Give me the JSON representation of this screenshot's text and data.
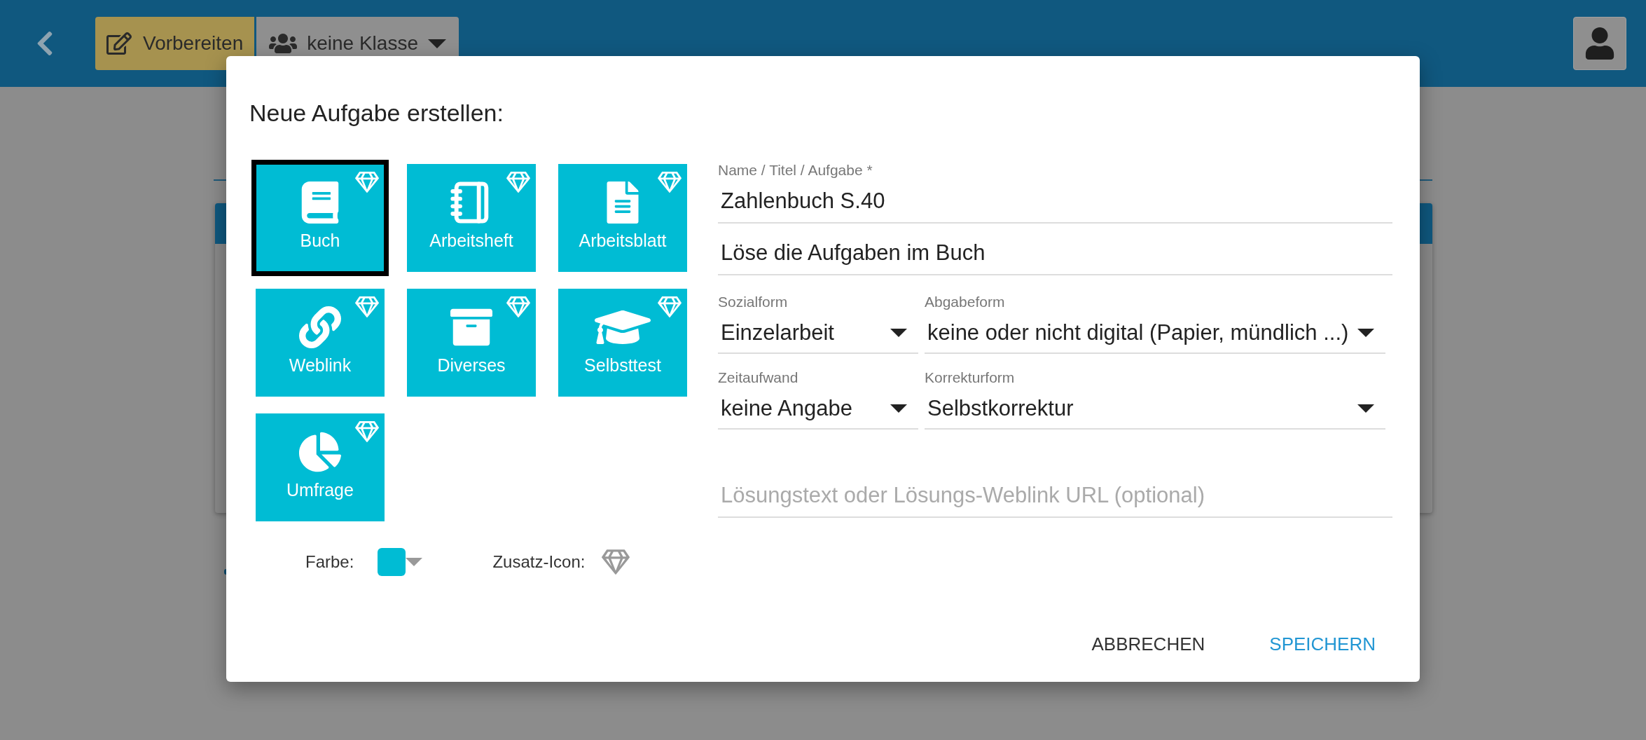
{
  "top_bar": {
    "mode_button": {
      "label": "Vorbereiten"
    },
    "class_select": {
      "value": "keine Klasse"
    }
  },
  "dialog": {
    "title": "Neue Aufgabe erstellen:",
    "tiles": [
      {
        "label": "Buch",
        "kind": "book",
        "selected": true
      },
      {
        "label": "Arbeitsheft",
        "kind": "notebook",
        "selected": false
      },
      {
        "label": "Arbeitsblatt",
        "kind": "sheet",
        "selected": false
      },
      {
        "label": "Weblink",
        "kind": "link",
        "selected": false
      },
      {
        "label": "Diverses",
        "kind": "box",
        "selected": false
      },
      {
        "label": "Selbsttest",
        "kind": "cap",
        "selected": false
      },
      {
        "label": "Umfrage",
        "kind": "pie",
        "selected": false
      }
    ],
    "name_field": {
      "label": "Name / Titel / Aufgabe *",
      "value": "Zahlenbuch S.40"
    },
    "description_field": {
      "value": "Löse die Aufgaben im Buch"
    },
    "selects": [
      {
        "label": "Sozialform",
        "value": "Einzelarbeit"
      },
      {
        "label": "Abgabeform",
        "value": "keine oder nicht digital (Papier, mündlich ...)"
      },
      {
        "label": "Zeitaufwand",
        "value": "keine Angabe"
      },
      {
        "label": "Korrekturform",
        "value": "Selbstkorrektur"
      }
    ],
    "solution_field": {
      "placeholder": "Lösungstext oder Lösungs-Weblink URL (optional)"
    },
    "color_picker": {
      "label": "Farbe:",
      "color": "#00bcd4"
    },
    "extra_icon_picker": {
      "label": "Zusatz-Icon:"
    },
    "actions": [
      {
        "label": "ABBRECHEN",
        "kind": "cancel"
      },
      {
        "label": "SPEICHERN",
        "kind": "primary"
      }
    ]
  }
}
